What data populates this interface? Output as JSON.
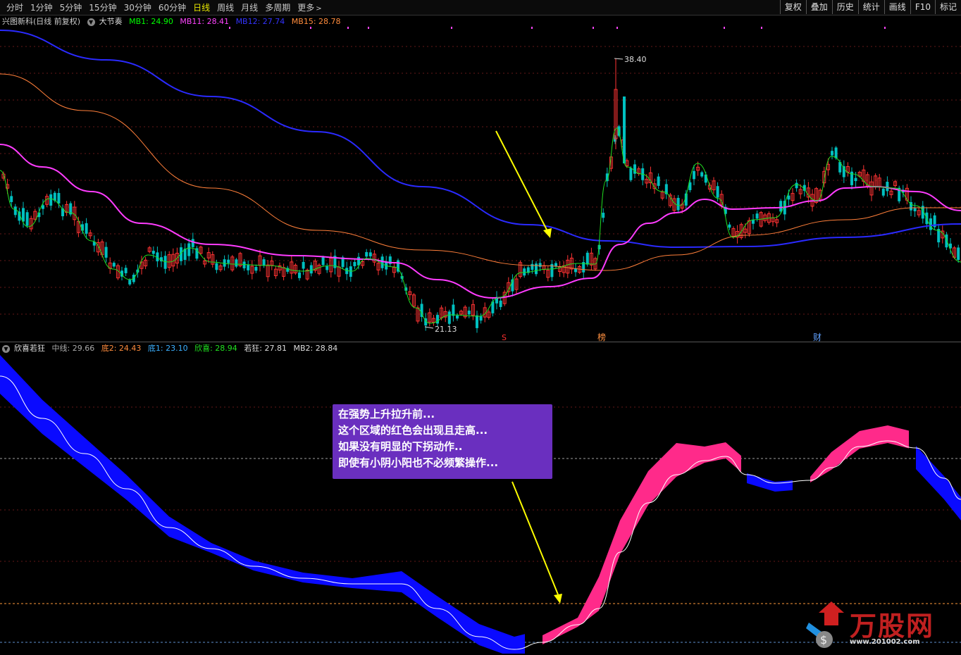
{
  "toolbar": {
    "periods": [
      "分时",
      "1分钟",
      "5分钟",
      "15分钟",
      "30分钟",
      "60分钟",
      "日线",
      "周线",
      "月线",
      "多周期",
      "更多"
    ],
    "active": "日线",
    "right_buttons": [
      "复权",
      "叠加",
      "历史",
      "统计",
      "画线",
      "F10",
      "标记"
    ]
  },
  "main_info": {
    "stock": "兴图新科(日线 前复权)",
    "indicator": "大节奏",
    "mb1_label": "MB1: 24.90",
    "mb11_label": "MB11: 28.41",
    "mb12_label": "MB12: 27.74",
    "mb15_label": "MB15: 28.78"
  },
  "sub_info": {
    "indicator": "欣喜若狂",
    "mid": "中线: 29.66",
    "di2": "底2: 24.43",
    "di1": "底1: 23.10",
    "xinxi": "欣喜: 28.94",
    "ruokuang": "若狂: 27.81",
    "mb2": "MB2: 28.84"
  },
  "annotations": {
    "high_price": "38.40",
    "low_price": "21.13",
    "marker_s": "S",
    "marker_bang": "榜",
    "marker_cai": "财"
  },
  "callout": {
    "line1": "在强势上升拉升前...",
    "line2": "这个区域的红色会出现且走高...",
    "line3": "如果没有明显的下拐动作..",
    "line4": "即使有小阴小阳也不必频繁操作..."
  },
  "logo": {
    "text": "万股网",
    "url": "www.201002.com"
  },
  "colors": {
    "up": "#ff3333",
    "down": "#00c0c0",
    "mb1": "#00ff00",
    "mb11": "#ff44ff",
    "mb12": "#3333ff",
    "mb15": "#ff8c3c",
    "ribbon_blue": "#0a0aff",
    "ribbon_pink": "#ff2a8a",
    "arrow": "#ffff00",
    "callout_bg": "#6a2fbf"
  }
}
